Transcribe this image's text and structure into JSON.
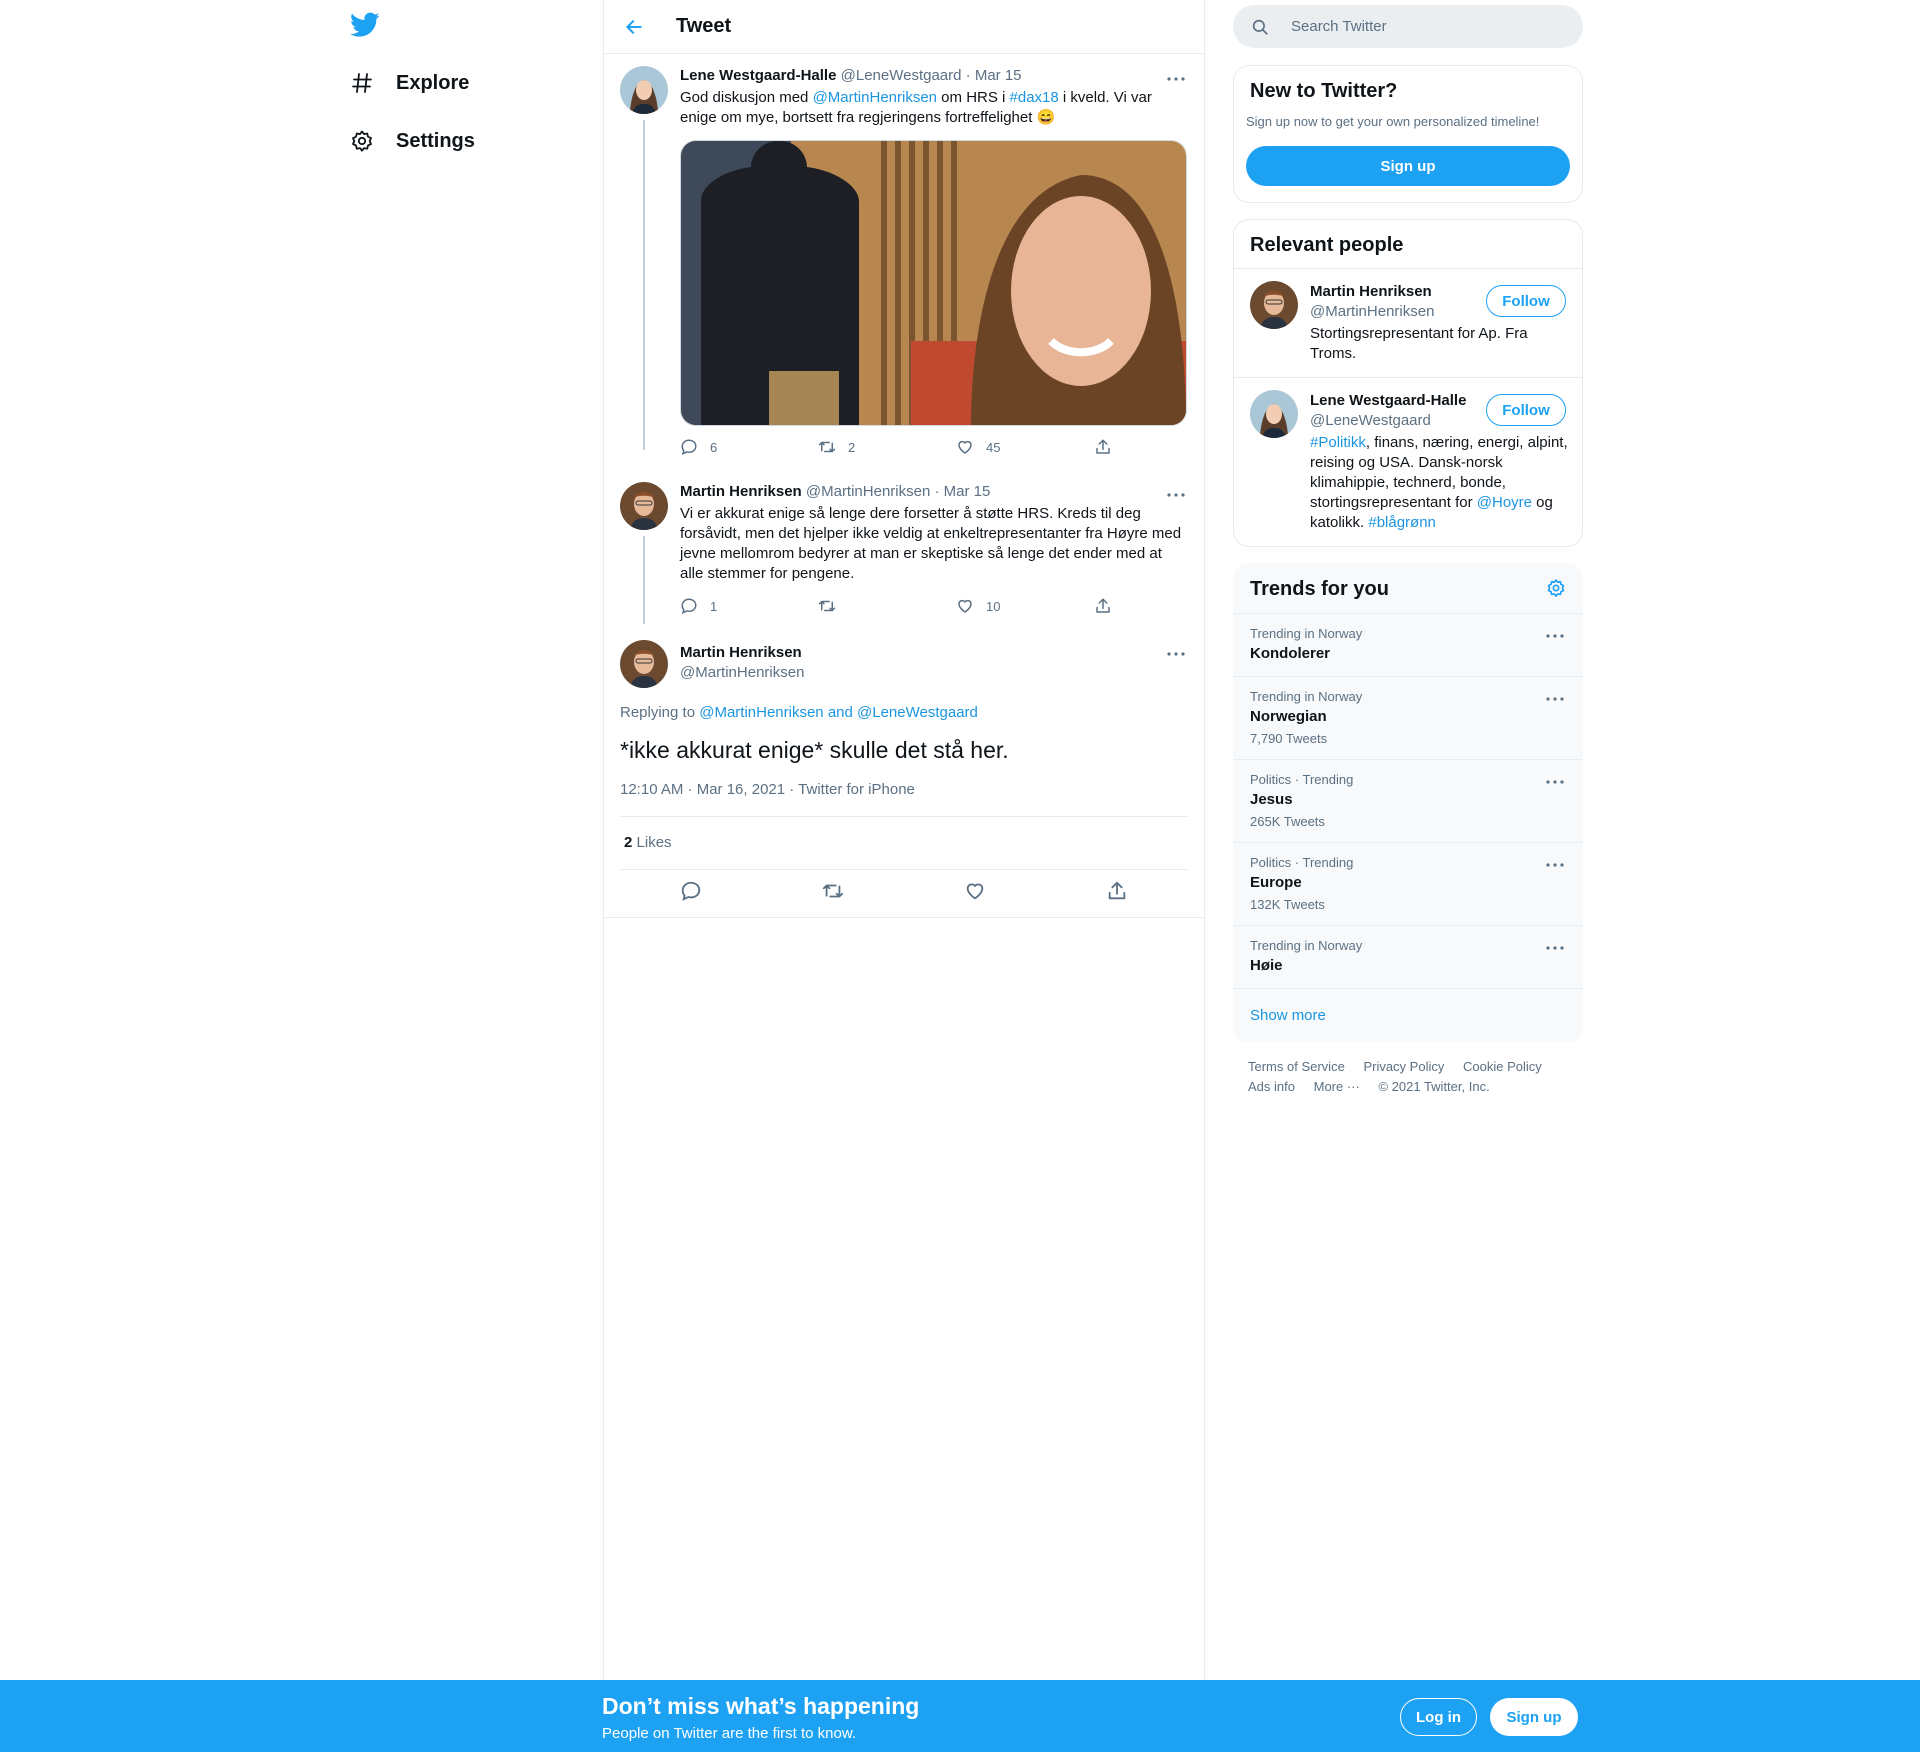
{
  "nav": {
    "logo_icon": "twitter-bird-icon",
    "items": [
      {
        "label": "Explore",
        "icon": "hashtag-icon"
      },
      {
        "label": "Settings",
        "icon": "gear-icon"
      }
    ]
  },
  "header": {
    "title": "Tweet",
    "back_icon": "arrow-left-icon"
  },
  "thread": [
    {
      "name": "Lene Westgaard-Halle",
      "handle": "@LeneWestgaard",
      "date": "· Mar 15",
      "text_parts": {
        "t1": "God diskusjon med ",
        "mention": "@MartinHenriksen",
        "t2": " om HRS i ",
        "hashtag": "#dax18",
        "t3": " i kveld. Vi var enige om mye, bortsett fra regjeringens fortreffelighet ",
        "emoji": "😄"
      },
      "replies": "6",
      "retweets": "2",
      "likes": "45"
    },
    {
      "name": "Martin Henriksen",
      "handle": "@MartinHenriksen",
      "date": "· Mar 15",
      "text": "Vi er akkurat enige så lenge dere forsetter å støtte HRS. Kreds til deg forsåvidt, men det hjelper ikke veldig at enkeltrepresentanter fra Høyre med jevne mellomrom bedyrer at man er skeptiske så lenge det ender med at alle stemmer for pengene.",
      "replies": "1",
      "retweets": "",
      "likes": "10"
    }
  ],
  "main_tweet": {
    "name": "Martin Henriksen",
    "handle": "@MartinHenriksen",
    "replying_prefix": "Replying to ",
    "replying_to": "@MartinHenriksen and @LeneWestgaard",
    "text": "*ikke akkurat enige* skulle det stå her.",
    "timestamp": "12:10 AM · Mar 16, 2021 · Twitter for iPhone",
    "likes_count": "2",
    "likes_label": "Likes"
  },
  "search": {
    "placeholder": "Search Twitter"
  },
  "new_to_twitter": {
    "title": "New to Twitter?",
    "subtitle": "Sign up now to get your own personalized timeline!",
    "button": "Sign up"
  },
  "relevant_people": {
    "title": "Relevant people",
    "people": [
      {
        "name": "Martin Henriksen",
        "handle": "@MartinHenriksen",
        "follow": "Follow",
        "bio": "Stortingsrepresentant for Ap. Fra Troms."
      },
      {
        "name": "Lene Westgaard-Halle",
        "handle": "@LeneWestgaard",
        "follow": "Follow",
        "bio_parts": {
          "h1": "#Politikk",
          "t1": ", finans, næring, energi, alpint, reising og USA. Dansk-norsk klimahippie, technerd, bonde, stortingsrepresentant for ",
          "m1": "@Hoyre",
          "t2": " og katolikk. ",
          "h2": "#blågrønn"
        }
      }
    ]
  },
  "trends": {
    "title": "Trends for you",
    "items": [
      {
        "context": "Trending in Norway",
        "name": "Kondolerer",
        "count": ""
      },
      {
        "context": "Trending in Norway",
        "name": "Norwegian",
        "count": "7,790 Tweets"
      },
      {
        "context": "Politics · Trending",
        "name": "Jesus",
        "count": "265K Tweets"
      },
      {
        "context": "Politics · Trending",
        "name": "Europe",
        "count": "132K Tweets"
      },
      {
        "context": "Trending in Norway",
        "name": "Høie",
        "count": ""
      }
    ],
    "show_more": "Show more"
  },
  "footer": {
    "terms": "Terms of Service",
    "privacy": "Privacy Policy",
    "cookie": "Cookie Policy",
    "ads": "Ads info",
    "more": "More ···",
    "copyright": "© 2021 Twitter, Inc."
  },
  "banner": {
    "title": "Don’t miss what’s happening",
    "subtitle": "People on Twitter are the first to know.",
    "login": "Log in",
    "signup": "Sign up"
  },
  "colors": {
    "accent": "#1da1f2",
    "link": "#1b95e0",
    "muted": "#5b7083",
    "border": "#e6ecf0"
  }
}
